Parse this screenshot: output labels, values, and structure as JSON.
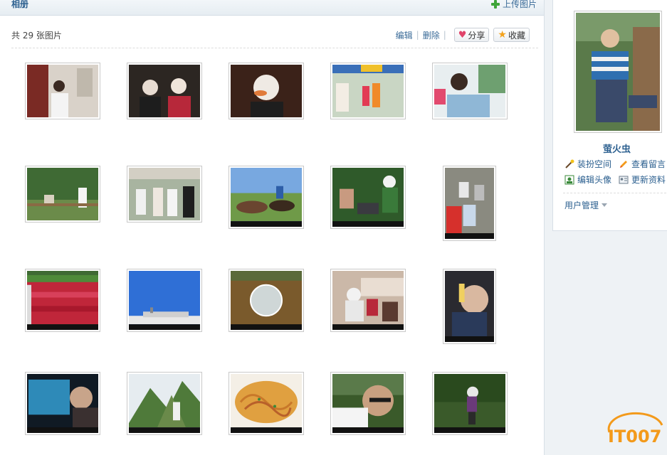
{
  "header": {
    "title": "相册",
    "upload_label": "上传图片"
  },
  "toolbar": {
    "count_text": "共 29 张图片",
    "edit_label": "编辑",
    "delete_label": "删除",
    "share_label": "分享",
    "favorite_label": "收藏"
  },
  "sidebar": {
    "username": "萤火虫",
    "menu": [
      "装扮空间",
      "查看留言",
      "编辑头像",
      "更新资料"
    ],
    "user_management": "用户管理"
  },
  "watermark": {
    "text": "IT007"
  },
  "colors": {
    "link": "#3a6b98",
    "accent_green": "#3fa53a",
    "watermark_orange": "#f39a1b"
  }
}
